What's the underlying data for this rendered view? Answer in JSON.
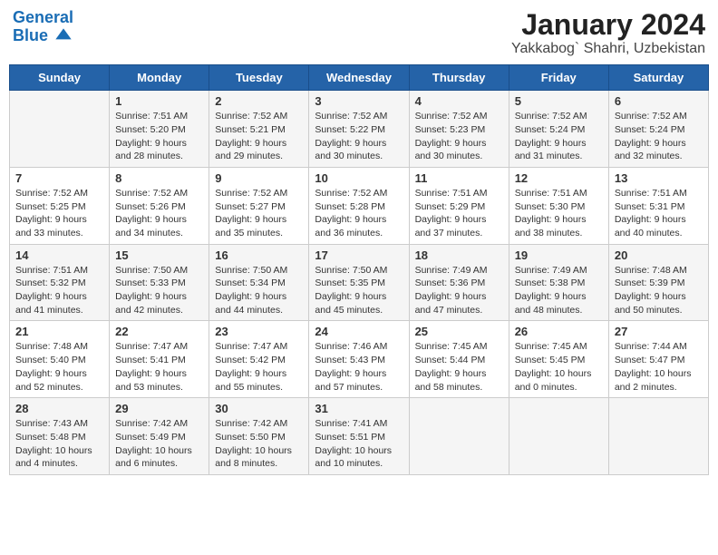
{
  "header": {
    "logo_line1": "General",
    "logo_line2": "Blue",
    "title": "January 2024",
    "subtitle": "Yakkabog` Shahri, Uzbekistan"
  },
  "weekdays": [
    "Sunday",
    "Monday",
    "Tuesday",
    "Wednesday",
    "Thursday",
    "Friday",
    "Saturday"
  ],
  "weeks": [
    [
      {
        "day": "",
        "info": ""
      },
      {
        "day": "1",
        "info": "Sunrise: 7:51 AM\nSunset: 5:20 PM\nDaylight: 9 hours\nand 28 minutes."
      },
      {
        "day": "2",
        "info": "Sunrise: 7:52 AM\nSunset: 5:21 PM\nDaylight: 9 hours\nand 29 minutes."
      },
      {
        "day": "3",
        "info": "Sunrise: 7:52 AM\nSunset: 5:22 PM\nDaylight: 9 hours\nand 30 minutes."
      },
      {
        "day": "4",
        "info": "Sunrise: 7:52 AM\nSunset: 5:23 PM\nDaylight: 9 hours\nand 30 minutes."
      },
      {
        "day": "5",
        "info": "Sunrise: 7:52 AM\nSunset: 5:24 PM\nDaylight: 9 hours\nand 31 minutes."
      },
      {
        "day": "6",
        "info": "Sunrise: 7:52 AM\nSunset: 5:24 PM\nDaylight: 9 hours\nand 32 minutes."
      }
    ],
    [
      {
        "day": "7",
        "info": "Sunrise: 7:52 AM\nSunset: 5:25 PM\nDaylight: 9 hours\nand 33 minutes."
      },
      {
        "day": "8",
        "info": "Sunrise: 7:52 AM\nSunset: 5:26 PM\nDaylight: 9 hours\nand 34 minutes."
      },
      {
        "day": "9",
        "info": "Sunrise: 7:52 AM\nSunset: 5:27 PM\nDaylight: 9 hours\nand 35 minutes."
      },
      {
        "day": "10",
        "info": "Sunrise: 7:52 AM\nSunset: 5:28 PM\nDaylight: 9 hours\nand 36 minutes."
      },
      {
        "day": "11",
        "info": "Sunrise: 7:51 AM\nSunset: 5:29 PM\nDaylight: 9 hours\nand 37 minutes."
      },
      {
        "day": "12",
        "info": "Sunrise: 7:51 AM\nSunset: 5:30 PM\nDaylight: 9 hours\nand 38 minutes."
      },
      {
        "day": "13",
        "info": "Sunrise: 7:51 AM\nSunset: 5:31 PM\nDaylight: 9 hours\nand 40 minutes."
      }
    ],
    [
      {
        "day": "14",
        "info": "Sunrise: 7:51 AM\nSunset: 5:32 PM\nDaylight: 9 hours\nand 41 minutes."
      },
      {
        "day": "15",
        "info": "Sunrise: 7:50 AM\nSunset: 5:33 PM\nDaylight: 9 hours\nand 42 minutes."
      },
      {
        "day": "16",
        "info": "Sunrise: 7:50 AM\nSunset: 5:34 PM\nDaylight: 9 hours\nand 44 minutes."
      },
      {
        "day": "17",
        "info": "Sunrise: 7:50 AM\nSunset: 5:35 PM\nDaylight: 9 hours\nand 45 minutes."
      },
      {
        "day": "18",
        "info": "Sunrise: 7:49 AM\nSunset: 5:36 PM\nDaylight: 9 hours\nand 47 minutes."
      },
      {
        "day": "19",
        "info": "Sunrise: 7:49 AM\nSunset: 5:38 PM\nDaylight: 9 hours\nand 48 minutes."
      },
      {
        "day": "20",
        "info": "Sunrise: 7:48 AM\nSunset: 5:39 PM\nDaylight: 9 hours\nand 50 minutes."
      }
    ],
    [
      {
        "day": "21",
        "info": "Sunrise: 7:48 AM\nSunset: 5:40 PM\nDaylight: 9 hours\nand 52 minutes."
      },
      {
        "day": "22",
        "info": "Sunrise: 7:47 AM\nSunset: 5:41 PM\nDaylight: 9 hours\nand 53 minutes."
      },
      {
        "day": "23",
        "info": "Sunrise: 7:47 AM\nSunset: 5:42 PM\nDaylight: 9 hours\nand 55 minutes."
      },
      {
        "day": "24",
        "info": "Sunrise: 7:46 AM\nSunset: 5:43 PM\nDaylight: 9 hours\nand 57 minutes."
      },
      {
        "day": "25",
        "info": "Sunrise: 7:45 AM\nSunset: 5:44 PM\nDaylight: 9 hours\nand 58 minutes."
      },
      {
        "day": "26",
        "info": "Sunrise: 7:45 AM\nSunset: 5:45 PM\nDaylight: 10 hours\nand 0 minutes."
      },
      {
        "day": "27",
        "info": "Sunrise: 7:44 AM\nSunset: 5:47 PM\nDaylight: 10 hours\nand 2 minutes."
      }
    ],
    [
      {
        "day": "28",
        "info": "Sunrise: 7:43 AM\nSunset: 5:48 PM\nDaylight: 10 hours\nand 4 minutes."
      },
      {
        "day": "29",
        "info": "Sunrise: 7:42 AM\nSunset: 5:49 PM\nDaylight: 10 hours\nand 6 minutes."
      },
      {
        "day": "30",
        "info": "Sunrise: 7:42 AM\nSunset: 5:50 PM\nDaylight: 10 hours\nand 8 minutes."
      },
      {
        "day": "31",
        "info": "Sunrise: 7:41 AM\nSunset: 5:51 PM\nDaylight: 10 hours\nand 10 minutes."
      },
      {
        "day": "",
        "info": ""
      },
      {
        "day": "",
        "info": ""
      },
      {
        "day": "",
        "info": ""
      }
    ]
  ]
}
